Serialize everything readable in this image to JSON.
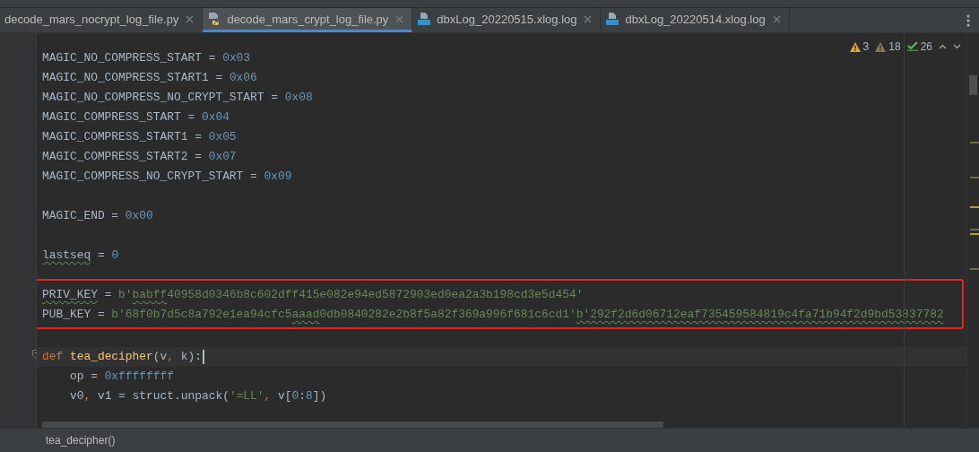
{
  "tabs": [
    {
      "label": "decode_mars_nocrypt_log_file.py",
      "selected": false
    },
    {
      "label": "decode_mars_crypt_log_file.py",
      "kind": "python",
      "selected": true
    },
    {
      "label": "dbxLog_20220515.xlog.log",
      "kind": "log",
      "selected": false
    },
    {
      "label": "dbxLog_20220514.xlog.log",
      "kind": "log",
      "selected": false
    }
  ],
  "inspections": [
    {
      "kind": "warning",
      "count": "3"
    },
    {
      "kind": "weak",
      "count": "18"
    },
    {
      "kind": "typo",
      "count": "26"
    }
  ],
  "lines": [
    {
      "tokens": [
        {
          "text": "MAGIC_NO_COMPRESS_START = ",
          "kind": "plain"
        },
        {
          "text": "0x03",
          "kind": "num"
        }
      ]
    },
    {
      "tokens": [
        {
          "text": "MAGIC_NO_COMPRESS_START1 = ",
          "kind": "plain"
        },
        {
          "text": "0x06",
          "kind": "num"
        }
      ]
    },
    {
      "tokens": [
        {
          "text": "MAGIC_NO_COMPRESS_NO_CRYPT_START = ",
          "kind": "plain"
        },
        {
          "text": "0x08",
          "kind": "num"
        }
      ]
    },
    {
      "tokens": [
        {
          "text": "MAGIC_COMPRESS_START = ",
          "kind": "plain"
        },
        {
          "text": "0x04",
          "kind": "num"
        }
      ]
    },
    {
      "tokens": [
        {
          "text": "MAGIC_COMPRESS_START1 = ",
          "kind": "plain"
        },
        {
          "text": "0x05",
          "kind": "num"
        }
      ]
    },
    {
      "tokens": [
        {
          "text": "MAGIC_COMPRESS_START2 = ",
          "kind": "plain"
        },
        {
          "text": "0x07",
          "kind": "num"
        }
      ]
    },
    {
      "tokens": [
        {
          "text": "MAGIC_COMPRESS_NO_CRYPT_START = ",
          "kind": "plain"
        },
        {
          "text": "0x09",
          "kind": "num"
        }
      ]
    },
    {
      "kind": "blank"
    },
    {
      "tokens": [
        {
          "text": "MAGIC_END = ",
          "kind": "plain"
        },
        {
          "text": "0x00",
          "kind": "num"
        }
      ]
    },
    {
      "kind": "blank"
    },
    {
      "tokens": [
        {
          "text": "lastseq",
          "kind": "plain",
          "typo": true
        },
        {
          "text": " = ",
          "kind": "plain"
        },
        {
          "text": "0",
          "kind": "num"
        }
      ]
    },
    {
      "kind": "blank"
    },
    {
      "boxed": true,
      "tokens": [
        {
          "text": "PRIV_KEY",
          "kind": "plain",
          "typo": true
        },
        {
          "text": " = ",
          "kind": "plain"
        },
        {
          "text": "b'",
          "kind": "str"
        },
        {
          "text": "babff",
          "kind": "str",
          "typo": true
        },
        {
          "text": "40958d0346b8c602dff415e082e94ed5872903ed0ea2a3b198cd3e5d454'",
          "kind": "str"
        }
      ]
    },
    {
      "boxed": true,
      "tokens": [
        {
          "text": "PUB_KEY = ",
          "kind": "plain"
        },
        {
          "text": "b'68f0b7d5c8a792e1ea94cfc5",
          "kind": "str"
        },
        {
          "text": "aaad",
          "kind": "str",
          "typo": true
        },
        {
          "text": "0db0840282e2b8f5a82f369a996f681c6cd1'",
          "kind": "str"
        },
        {
          "text": "b'292f2d6d06712eaf735459584819c4fa71b94f2d9bd53837782",
          "kind": "str",
          "typo": true
        }
      ]
    },
    {
      "kind": "blank"
    },
    {
      "tokens": [
        {
          "text": "def ",
          "kind": "kw"
        },
        {
          "text": "tea_decipher",
          "kind": "fn"
        },
        {
          "text": "(v",
          "kind": "plain"
        },
        {
          "text": ",",
          "kind": "kw"
        },
        {
          "text": " k):",
          "kind": "plain"
        }
      ],
      "current": true,
      "foldable": true
    },
    {
      "tokens": [
        {
          "text": "    op = ",
          "kind": "plain"
        },
        {
          "text": "0xffffffff",
          "kind": "num"
        }
      ]
    },
    {
      "tokens": [
        {
          "text": "    v0",
          "kind": "plain"
        },
        {
          "text": ",",
          "kind": "kw"
        },
        {
          "text": " v1 = struct.unpack(",
          "kind": "plain"
        },
        {
          "text": "'=LL'",
          "kind": "str"
        },
        {
          "text": ",",
          "kind": "kw"
        },
        {
          "text": " v[",
          "kind": "plain"
        },
        {
          "text": "0",
          "kind": "num"
        },
        {
          "text": ":",
          "kind": "plain"
        },
        {
          "text": "8",
          "kind": "num"
        },
        {
          "text": "])",
          "kind": "plain"
        }
      ]
    }
  ],
  "status_bar": {
    "breadcrumb": "tea_decipher()"
  }
}
